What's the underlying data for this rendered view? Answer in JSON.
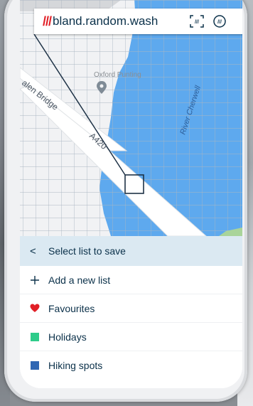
{
  "search_bar": {
    "prefix": "///",
    "address": "bland.random.wash",
    "icons": [
      "scan-icon",
      "voice-icon"
    ]
  },
  "map": {
    "labels": {
      "poi": "Oxford Punting",
      "bridge": "alen Bridge",
      "road": "A420",
      "river": "River Cherwell"
    },
    "colors": {
      "water": "#5ea9ee",
      "land": "#f1f2f4",
      "grid": "#a9b6c2",
      "road": "#ffffff"
    }
  },
  "panel": {
    "header": "Select list to save",
    "items": [
      {
        "label": "Add a new list",
        "icon": "plus-icon"
      },
      {
        "label": "Favourites",
        "icon": "heart-icon",
        "color": "#e11f26"
      },
      {
        "label": "Holidays",
        "icon": "square-icon",
        "color": "#2ecc8a"
      },
      {
        "label": "Hiking spots",
        "icon": "square-icon",
        "color": "#2f66b3"
      }
    ]
  }
}
